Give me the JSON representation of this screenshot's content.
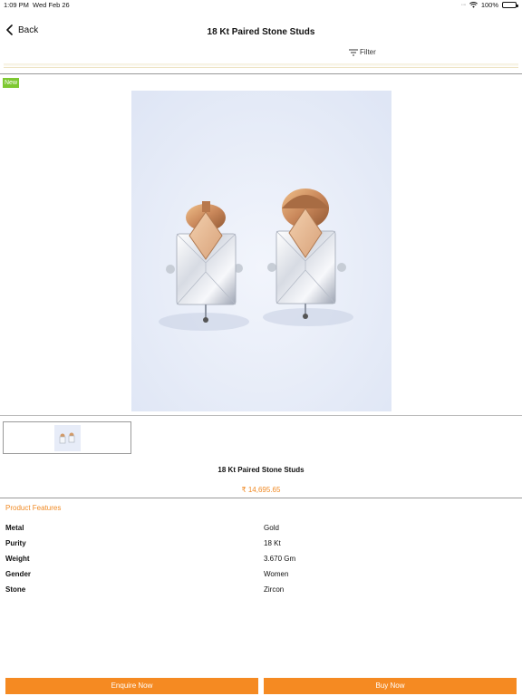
{
  "status_bar": {
    "time": "1:09 PM",
    "date": "Wed Feb 26",
    "battery": "100%"
  },
  "nav": {
    "back_label": "Back",
    "title": "18 Kt Paired Stone Studs"
  },
  "filter": {
    "label": "Filter"
  },
  "badge": {
    "label": "New"
  },
  "product": {
    "name": "18 Kt Paired Stone Studs",
    "price": "₹ 14,695.65"
  },
  "features": {
    "heading": "Product Features",
    "rows": [
      {
        "key": "Metal",
        "value": "Gold"
      },
      {
        "key": "Purity",
        "value": "18 Kt"
      },
      {
        "key": "Weight",
        "value": "3.670 Gm"
      },
      {
        "key": "Gender",
        "value": "Women"
      },
      {
        "key": "Stone",
        "value": "Zircon"
      }
    ]
  },
  "actions": {
    "enquire_label": "Enquire Now",
    "buy_label": "Buy Now"
  },
  "colors": {
    "accent": "#f58a22",
    "price": "#f08a24",
    "new_badge": "#7ec832"
  }
}
